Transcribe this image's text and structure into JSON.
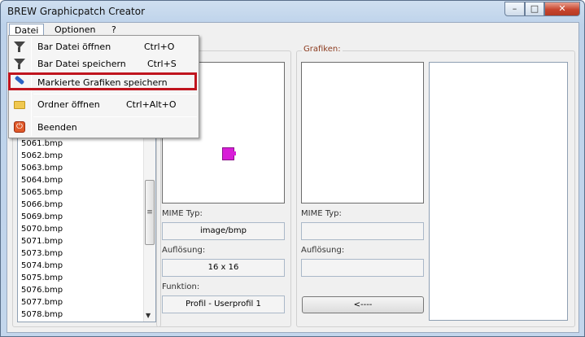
{
  "window": {
    "title": "BREW Graphicpatch Creator",
    "min_symbol": "–",
    "max_symbol": "□",
    "close_symbol": "✕"
  },
  "menu": {
    "items": [
      "Datei",
      "Optionen",
      "?"
    ]
  },
  "dropdown": {
    "items": [
      {
        "label": "Bar Datei öffnen",
        "shortcut": "Ctrl+O",
        "icon": "filter-icon"
      },
      {
        "label": "Bar Datei speichern",
        "shortcut": "Ctrl+S",
        "icon": "filter-icon"
      },
      {
        "label": "Markierte Grafiken speichern",
        "shortcut": "",
        "icon": "brush-icon",
        "highlighted": true
      },
      {
        "label": "Ordner öffnen",
        "shortcut": "Ctrl+Alt+O",
        "icon": "folder-icon"
      },
      {
        "label": "Beenden",
        "shortcut": "",
        "icon": "exit-icon"
      }
    ]
  },
  "file_list": {
    "items": [
      "5061.bmp",
      "5062.bmp",
      "5063.bmp",
      "5064.bmp",
      "5065.bmp",
      "5066.bmp",
      "5069.bmp",
      "5070.bmp",
      "5071.bmp",
      "5073.bmp",
      "5074.bmp",
      "5075.bmp",
      "5076.bmp",
      "5077.bmp",
      "5078.bmp"
    ],
    "scroll_grip": "≡",
    "scroll_down": "▼"
  },
  "left_group": {
    "mime_label": "MIME Typ:",
    "mime_value": "image/bmp",
    "resolution_label": "Auflösung:",
    "resolution_value": "16 x 16",
    "function_label": "Funktion:",
    "function_value": "Profil - Userprofil 1"
  },
  "right_group": {
    "title": "Grafiken:",
    "mime_label": "MIME Typ:",
    "mime_value": "",
    "resolution_label": "Auflösung:",
    "resolution_value": "",
    "button_label": "<----"
  },
  "colors": {
    "highlight": "#c0141e",
    "group_title": "#8b3a1e",
    "thumbnail": "#d81ed8"
  }
}
